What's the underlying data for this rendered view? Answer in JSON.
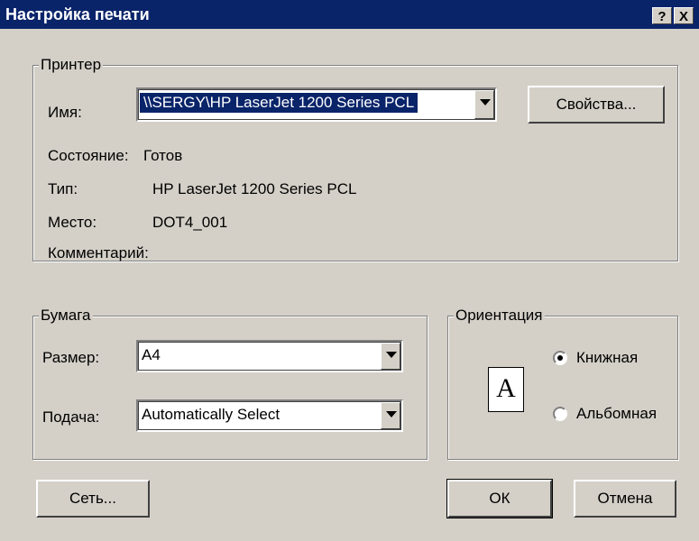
{
  "window": {
    "title": "Настройка печати",
    "help_label": "?",
    "close_label": "X"
  },
  "printer_group": {
    "legend": "Принтер",
    "name_label": "Имя:",
    "name_value": "\\\\SERGY\\HP LaserJet 1200 Series PCL",
    "properties_button": "Свойства...",
    "status_label": "Состояние:",
    "status_value": "Готов",
    "type_label": "Тип:",
    "type_value": "HP LaserJet 1200 Series PCL",
    "location_label": "Место:",
    "location_value": "DOT4_001",
    "comment_label": "Комментарий:",
    "comment_value": ""
  },
  "paper_group": {
    "legend": "Бумага",
    "size_label": "Размер:",
    "size_value": "A4",
    "source_label": "Подача:",
    "source_value": "Automatically Select"
  },
  "orientation_group": {
    "legend": "Ориентация",
    "page_icon_letter": "A",
    "options": [
      {
        "label": "Книжная",
        "selected": true
      },
      {
        "label": "Альбомная",
        "selected": false
      }
    ]
  },
  "buttons": {
    "network": "Сеть...",
    "ok": "ОК",
    "cancel": "Отмена"
  }
}
